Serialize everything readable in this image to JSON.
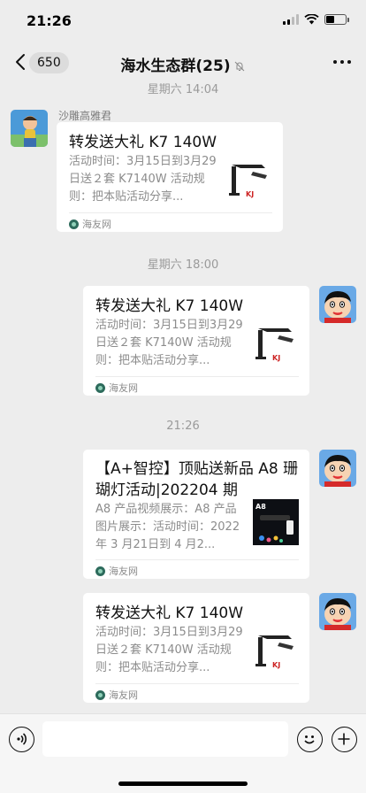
{
  "status_bar": {
    "time": "21:26"
  },
  "nav": {
    "unread_count": "650",
    "title": "海水生态群(25)"
  },
  "chat": {
    "timestamps": [
      "星期六 14:04",
      "星期六 18:00",
      "21:26"
    ],
    "sender_name": "沙雕高雅君",
    "messages": [
      {
        "title": "转发送大礼  K7 140W",
        "desc": "活动时间：3月15日到3月29日送２套 K7140W 活动规则：把本贴活动分享...",
        "source": "海友网"
      },
      {
        "title": "转发送大礼  K7 140W",
        "desc": "活动时间：3月15日到3月29日送２套 K7140W 活动规则：把本贴活动分享...",
        "source": "海友网"
      },
      {
        "title": "【A+智控】顶贴送新品 A8 珊瑚灯活动|202204 期",
        "desc": "A8 产品视频展示：A8 产品图片展示：活动时间：2022 年 3 月21日到 4 月2...",
        "source": "海友网",
        "thumb_label": "A8"
      },
      {
        "title": "转发送大礼  K7 140W",
        "desc": "活动时间：3月15日到3月29日送２套 K7140W 活动规则：把本贴活动分享...",
        "source": "海友网"
      }
    ]
  },
  "input": {
    "placeholder": ""
  },
  "colors": {
    "background": "#ededed",
    "card": "#ffffff",
    "muted_text": "#8c8c8c",
    "source_icon": "#2d6b5c"
  },
  "icons": [
    "back-icon",
    "mute-icon",
    "more-icon",
    "voice-icon",
    "emoji-icon",
    "plus-icon",
    "wifi-icon",
    "signal-icon",
    "battery-icon"
  ]
}
